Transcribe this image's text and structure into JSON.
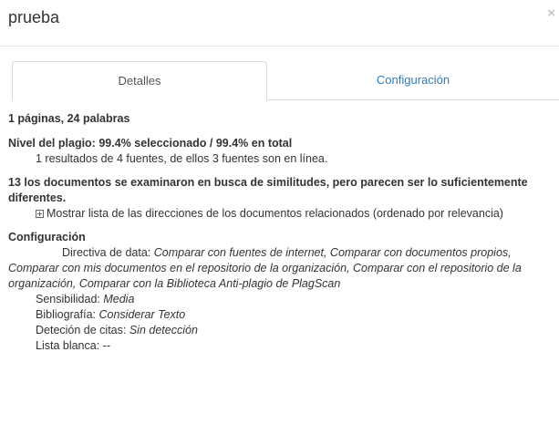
{
  "modal": {
    "title": "prueba",
    "close_symbol": "×"
  },
  "tabs": [
    {
      "label": "Detalles",
      "active": true
    },
    {
      "label": "Configuración",
      "active": false
    }
  ],
  "details": {
    "summary": "1 páginas, 24 palabras",
    "plagiarism": {
      "heading": "Nivel del plagio: 99.4% seleccionado / 99.4% en total",
      "detail": "1 resultados de 4 fuentes, de ellos 3 fuentes son en línea."
    },
    "documents": {
      "heading": "13 los documentos se examinaron en busca de similitudes, pero parecen ser lo suficientemente diferentes.",
      "toggle_label": "Mostrar lista de las direcciones de los documentos relacionados (ordenado por relevancia)"
    },
    "configuration": {
      "heading": "Configuración",
      "data_policy_label": "Directiva de data: ",
      "data_policy_value": "Comparar con fuentes de internet, Comparar con documentos propios, Comparar con mis documentos en el repositorio de la organización, Comparar con el repositorio de la organización, Comparar con la Biblioteca Anti-plagio de PlagScan",
      "sensitivity_label": "Sensibilidad: ",
      "sensitivity_value": "Media",
      "bibliography_label": "Bibliografía: ",
      "bibliography_value": "Considerar Texto",
      "citation_label": "Deteción de citas: ",
      "citation_value": "Sin detección",
      "whitelist_label": "Lista blanca: ",
      "whitelist_value": "--"
    }
  },
  "colors": {
    "link": "#337ab7",
    "text": "#333333",
    "border": "#dddddd"
  }
}
